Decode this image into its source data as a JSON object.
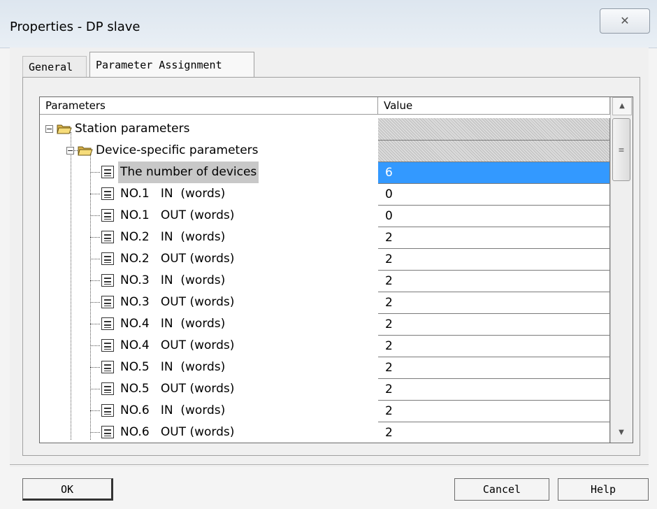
{
  "window": {
    "title": "Properties - DP slave",
    "close_glyph": "✕"
  },
  "tabs": [
    {
      "label": "General"
    },
    {
      "label": "Parameter Assignment"
    }
  ],
  "grid": {
    "col_parameters": "Parameters",
    "col_value": "Value",
    "rows": [
      {
        "label": "Station parameters",
        "value": "",
        "kind": "folder"
      },
      {
        "label": "Device-specific parameters",
        "value": "",
        "kind": "folder"
      },
      {
        "label": "The number of devices",
        "value": "6",
        "kind": "param",
        "selected": true
      },
      {
        "label": "NO.1   IN  (words)",
        "value": "0",
        "kind": "param"
      },
      {
        "label": "NO.1   OUT (words)",
        "value": "0",
        "kind": "param"
      },
      {
        "label": "NO.2   IN  (words)",
        "value": "2",
        "kind": "param"
      },
      {
        "label": "NO.2   OUT (words)",
        "value": "2",
        "kind": "param"
      },
      {
        "label": "NO.3   IN  (words)",
        "value": "2",
        "kind": "param"
      },
      {
        "label": "NO.3   OUT (words)",
        "value": "2",
        "kind": "param"
      },
      {
        "label": "NO.4   IN  (words)",
        "value": "2",
        "kind": "param"
      },
      {
        "label": "NO.4   OUT (words)",
        "value": "2",
        "kind": "param"
      },
      {
        "label": "NO.5   IN  (words)",
        "value": "2",
        "kind": "param"
      },
      {
        "label": "NO.5   OUT (words)",
        "value": "2",
        "kind": "param"
      },
      {
        "label": "NO.6   IN  (words)",
        "value": "2",
        "kind": "param"
      },
      {
        "label": "NO.6   OUT (words)",
        "value": "2",
        "kind": "param"
      }
    ]
  },
  "buttons": {
    "ok": "OK",
    "cancel": "Cancel",
    "help": "Help"
  },
  "colors": {
    "selection": "#3399ff",
    "title_gradient_top": "#dde6ef"
  }
}
